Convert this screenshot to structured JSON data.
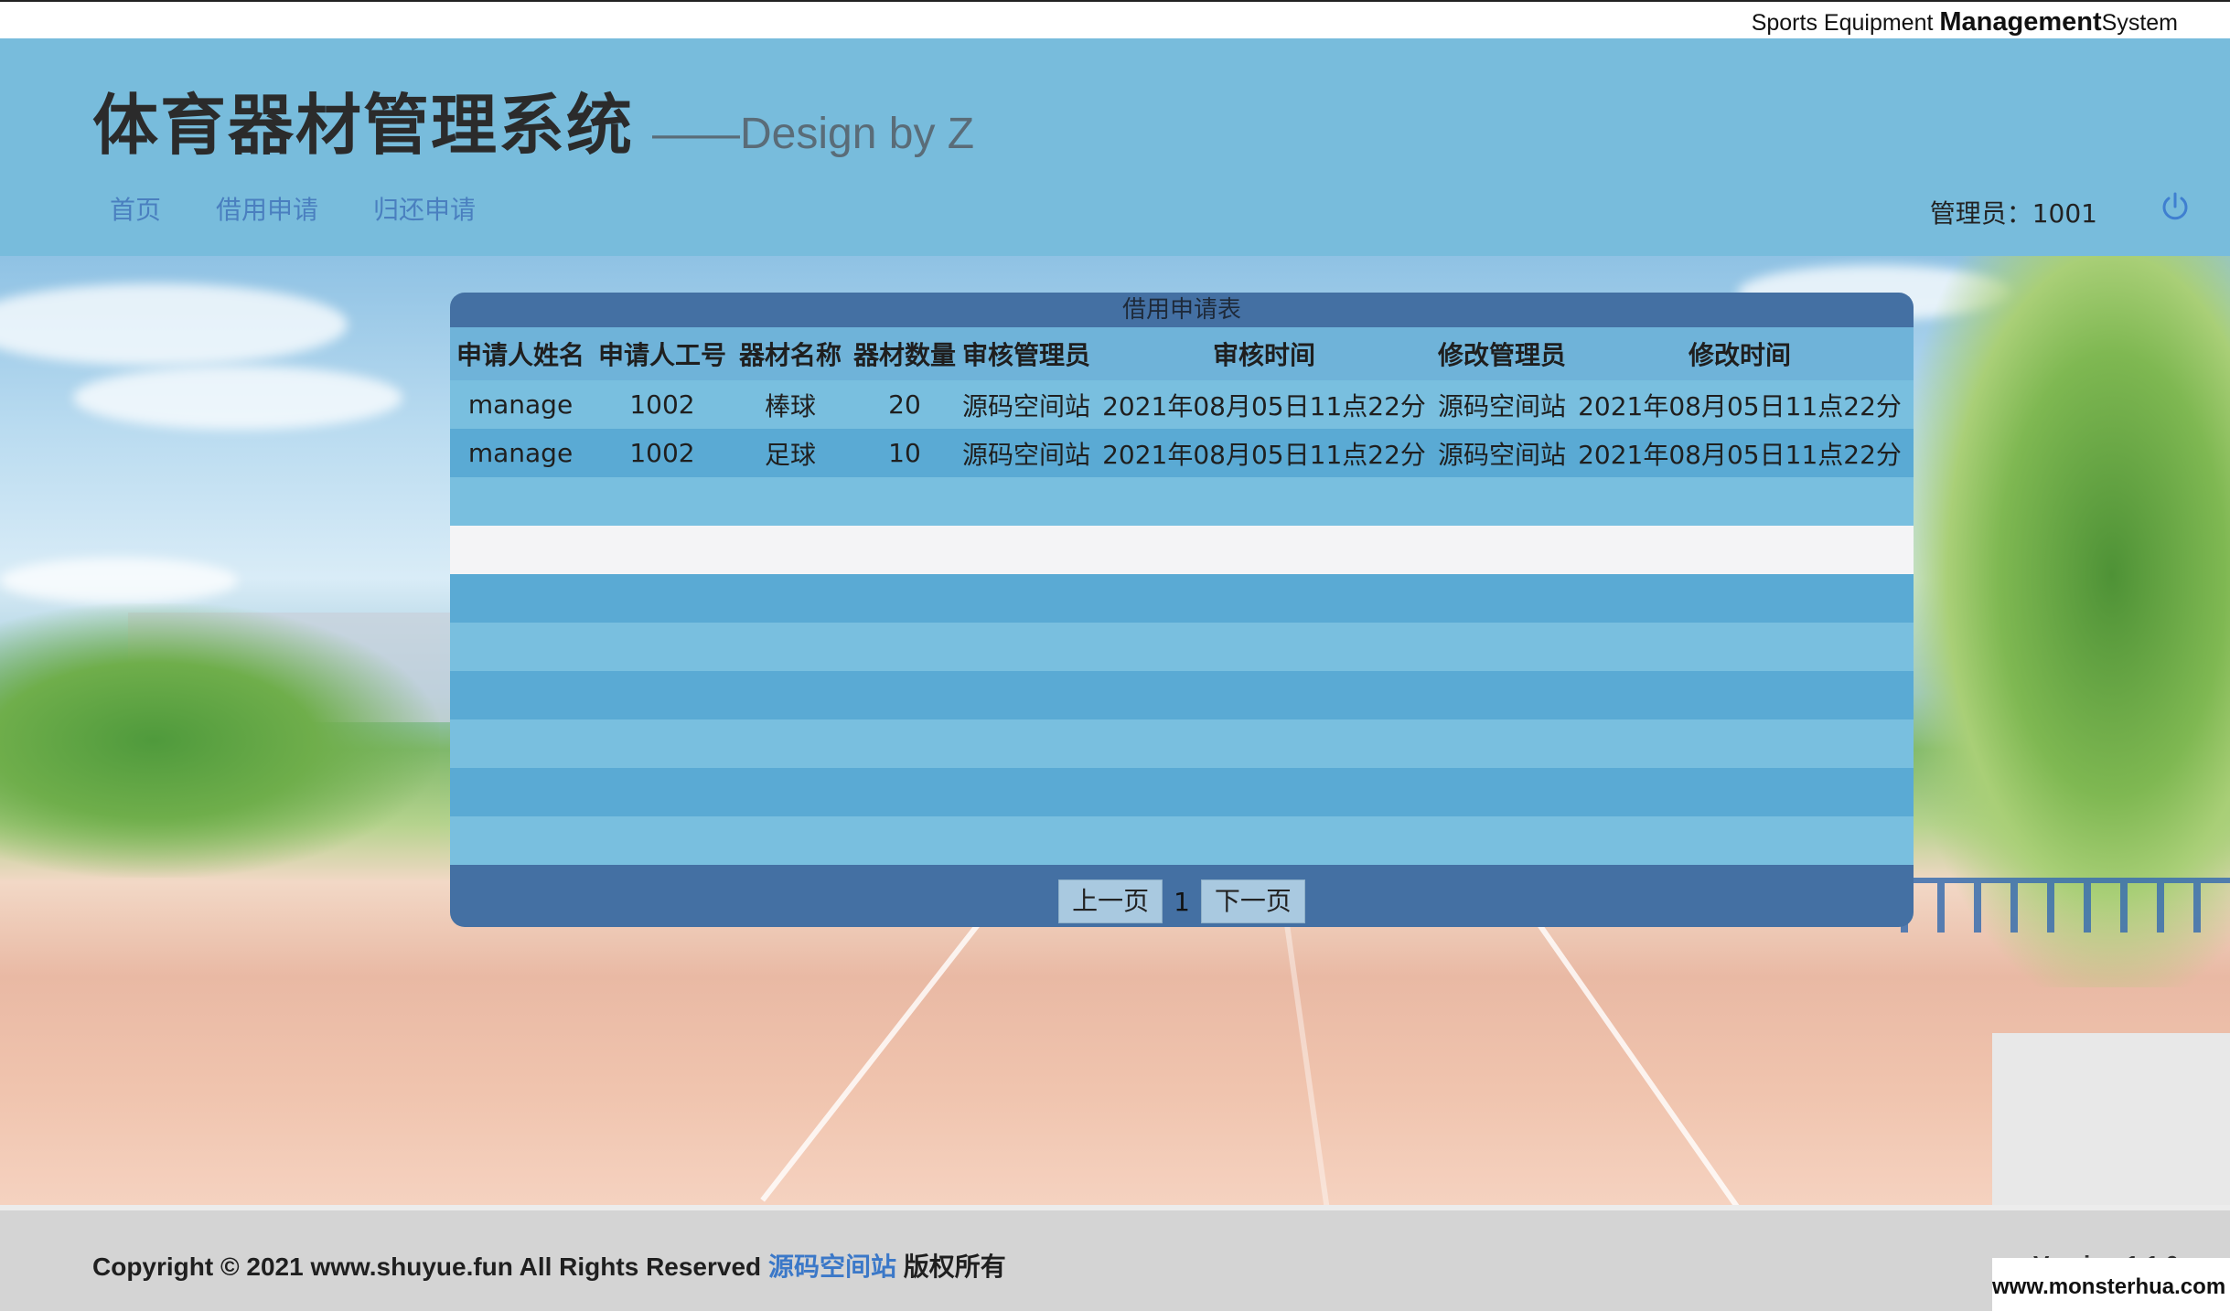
{
  "topbar": {
    "tagline_prefix": "Sports Equipment ",
    "tagline_bold": "Management",
    "tagline_suffix": "System"
  },
  "header": {
    "title": "体育器材管理系统",
    "subtitle": "——Design by Z",
    "nav": [
      "首页",
      "借用申请",
      "归还申请"
    ],
    "admin_label": "管理员：1001",
    "logout_icon": "power-icon"
  },
  "table": {
    "caption": "借用申请表",
    "columns": [
      "申请人姓名",
      "申请人工号",
      "器材名称",
      "器材数量",
      "审核管理员",
      "审核时间",
      "修改管理员",
      "修改时间"
    ],
    "rows": [
      [
        "manage",
        "1002",
        "棒球",
        "20",
        "源码空间站",
        "2021年08月05日11点22分",
        "源码空间站",
        "2021年08月05日11点22分"
      ],
      [
        "manage",
        "1002",
        "足球",
        "10",
        "源码空间站",
        "2021年08月05日11点22分",
        "源码空间站",
        "2021年08月05日11点22分"
      ]
    ]
  },
  "pager": {
    "prev": "上一页",
    "page": "1",
    "next": "下一页"
  },
  "footer": {
    "copy_prefix": "Copyright © 2021 www.shuyue.fun All Rights Reserved ",
    "copy_link": "源码空间站",
    "copy_suffix": " 版权所有",
    "version": "Version 1.1.0"
  },
  "watermark": "www.monsterhua.com",
  "colors": {
    "header_bg": "#78bcdc",
    "panel_bg": "#4470a3",
    "nav_link": "#4a7fbf",
    "footer_bg": "#d4d4d4"
  }
}
